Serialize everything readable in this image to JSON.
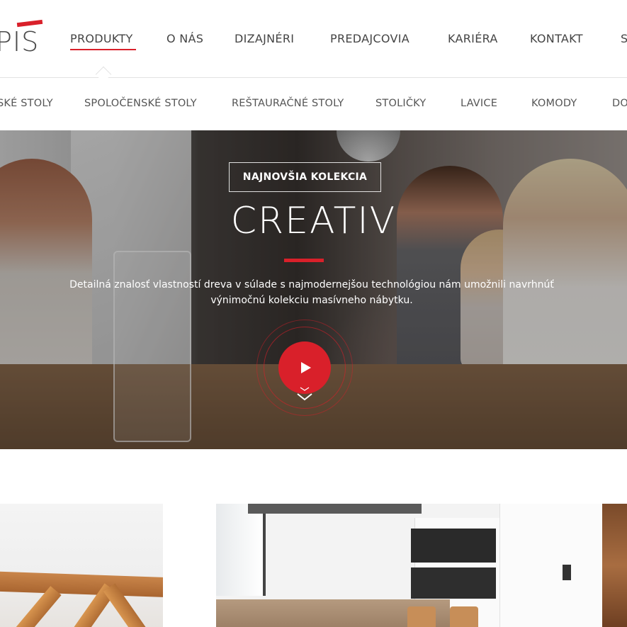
{
  "brand": {
    "logo_text": "PIS",
    "accent_color": "#d9202a"
  },
  "main_nav": {
    "items": [
      {
        "label": "PRODUKTY",
        "active": true
      },
      {
        "label": "O NÁS"
      },
      {
        "label": "DIZAJNÉRI"
      },
      {
        "label": "PREDAJCOVIA"
      },
      {
        "label": "KARIÉRA"
      },
      {
        "label": "KONTAKT"
      },
      {
        "label": "S"
      }
    ]
  },
  "sub_nav": {
    "items": [
      {
        "label": "SKÉ STOLY"
      },
      {
        "label": "SPOLOČENSKÉ STOLY"
      },
      {
        "label": "REŠTAURAČNÉ STOLY"
      },
      {
        "label": "STOLIČKY"
      },
      {
        "label": "LAVICE"
      },
      {
        "label": "KOMODY"
      },
      {
        "label": "DO"
      }
    ]
  },
  "hero": {
    "badge": "NAJNOVŠIA KOLEKCIA",
    "title": "CREATIV",
    "description_line1": "Detailná znalosť vlastností dreva v súlade s najmodernejšou technológiou nám umožnili navrhnúť",
    "description_line2": "výnimočnú kolekciu masívneho nábytku.",
    "play_icon": "play-icon",
    "scroll_icon": "chevron-down-icon"
  }
}
